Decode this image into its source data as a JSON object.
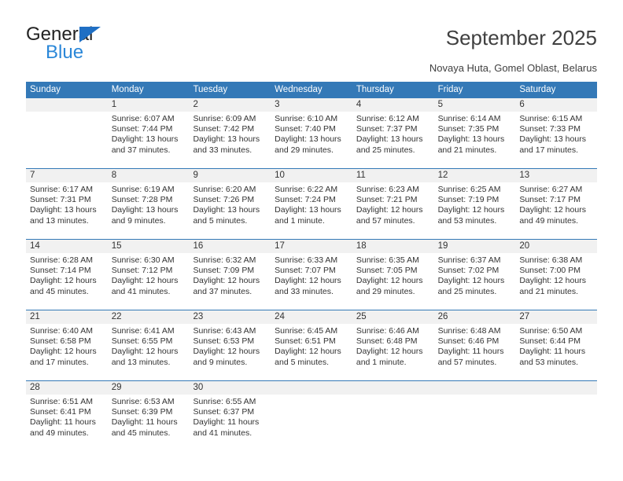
{
  "brand": {
    "name_dark": "General",
    "name_blue": "Blue",
    "accent_blue": "#2a87d8",
    "header_blue": "#3479b7"
  },
  "header": {
    "title": "September 2025",
    "subtitle": "Novaya Huta, Gomel Oblast, Belarus"
  },
  "calendar": {
    "weekdays": [
      "Sunday",
      "Monday",
      "Tuesday",
      "Wednesday",
      "Thursday",
      "Friday",
      "Saturday"
    ],
    "weeks": [
      [
        {
          "day": "",
          "sunrise": "",
          "sunset": "",
          "daylight_a": "",
          "daylight_b": ""
        },
        {
          "day": "1",
          "sunrise": "Sunrise: 6:07 AM",
          "sunset": "Sunset: 7:44 PM",
          "daylight_a": "Daylight: 13 hours",
          "daylight_b": "and 37 minutes."
        },
        {
          "day": "2",
          "sunrise": "Sunrise: 6:09 AM",
          "sunset": "Sunset: 7:42 PM",
          "daylight_a": "Daylight: 13 hours",
          "daylight_b": "and 33 minutes."
        },
        {
          "day": "3",
          "sunrise": "Sunrise: 6:10 AM",
          "sunset": "Sunset: 7:40 PM",
          "daylight_a": "Daylight: 13 hours",
          "daylight_b": "and 29 minutes."
        },
        {
          "day": "4",
          "sunrise": "Sunrise: 6:12 AM",
          "sunset": "Sunset: 7:37 PM",
          "daylight_a": "Daylight: 13 hours",
          "daylight_b": "and 25 minutes."
        },
        {
          "day": "5",
          "sunrise": "Sunrise: 6:14 AM",
          "sunset": "Sunset: 7:35 PM",
          "daylight_a": "Daylight: 13 hours",
          "daylight_b": "and 21 minutes."
        },
        {
          "day": "6",
          "sunrise": "Sunrise: 6:15 AM",
          "sunset": "Sunset: 7:33 PM",
          "daylight_a": "Daylight: 13 hours",
          "daylight_b": "and 17 minutes."
        }
      ],
      [
        {
          "day": "7",
          "sunrise": "Sunrise: 6:17 AM",
          "sunset": "Sunset: 7:31 PM",
          "daylight_a": "Daylight: 13 hours",
          "daylight_b": "and 13 minutes."
        },
        {
          "day": "8",
          "sunrise": "Sunrise: 6:19 AM",
          "sunset": "Sunset: 7:28 PM",
          "daylight_a": "Daylight: 13 hours",
          "daylight_b": "and 9 minutes."
        },
        {
          "day": "9",
          "sunrise": "Sunrise: 6:20 AM",
          "sunset": "Sunset: 7:26 PM",
          "daylight_a": "Daylight: 13 hours",
          "daylight_b": "and 5 minutes."
        },
        {
          "day": "10",
          "sunrise": "Sunrise: 6:22 AM",
          "sunset": "Sunset: 7:24 PM",
          "daylight_a": "Daylight: 13 hours",
          "daylight_b": "and 1 minute."
        },
        {
          "day": "11",
          "sunrise": "Sunrise: 6:23 AM",
          "sunset": "Sunset: 7:21 PM",
          "daylight_a": "Daylight: 12 hours",
          "daylight_b": "and 57 minutes."
        },
        {
          "day": "12",
          "sunrise": "Sunrise: 6:25 AM",
          "sunset": "Sunset: 7:19 PM",
          "daylight_a": "Daylight: 12 hours",
          "daylight_b": "and 53 minutes."
        },
        {
          "day": "13",
          "sunrise": "Sunrise: 6:27 AM",
          "sunset": "Sunset: 7:17 PM",
          "daylight_a": "Daylight: 12 hours",
          "daylight_b": "and 49 minutes."
        }
      ],
      [
        {
          "day": "14",
          "sunrise": "Sunrise: 6:28 AM",
          "sunset": "Sunset: 7:14 PM",
          "daylight_a": "Daylight: 12 hours",
          "daylight_b": "and 45 minutes."
        },
        {
          "day": "15",
          "sunrise": "Sunrise: 6:30 AM",
          "sunset": "Sunset: 7:12 PM",
          "daylight_a": "Daylight: 12 hours",
          "daylight_b": "and 41 minutes."
        },
        {
          "day": "16",
          "sunrise": "Sunrise: 6:32 AM",
          "sunset": "Sunset: 7:09 PM",
          "daylight_a": "Daylight: 12 hours",
          "daylight_b": "and 37 minutes."
        },
        {
          "day": "17",
          "sunrise": "Sunrise: 6:33 AM",
          "sunset": "Sunset: 7:07 PM",
          "daylight_a": "Daylight: 12 hours",
          "daylight_b": "and 33 minutes."
        },
        {
          "day": "18",
          "sunrise": "Sunrise: 6:35 AM",
          "sunset": "Sunset: 7:05 PM",
          "daylight_a": "Daylight: 12 hours",
          "daylight_b": "and 29 minutes."
        },
        {
          "day": "19",
          "sunrise": "Sunrise: 6:37 AM",
          "sunset": "Sunset: 7:02 PM",
          "daylight_a": "Daylight: 12 hours",
          "daylight_b": "and 25 minutes."
        },
        {
          "day": "20",
          "sunrise": "Sunrise: 6:38 AM",
          "sunset": "Sunset: 7:00 PM",
          "daylight_a": "Daylight: 12 hours",
          "daylight_b": "and 21 minutes."
        }
      ],
      [
        {
          "day": "21",
          "sunrise": "Sunrise: 6:40 AM",
          "sunset": "Sunset: 6:58 PM",
          "daylight_a": "Daylight: 12 hours",
          "daylight_b": "and 17 minutes."
        },
        {
          "day": "22",
          "sunrise": "Sunrise: 6:41 AM",
          "sunset": "Sunset: 6:55 PM",
          "daylight_a": "Daylight: 12 hours",
          "daylight_b": "and 13 minutes."
        },
        {
          "day": "23",
          "sunrise": "Sunrise: 6:43 AM",
          "sunset": "Sunset: 6:53 PM",
          "daylight_a": "Daylight: 12 hours",
          "daylight_b": "and 9 minutes."
        },
        {
          "day": "24",
          "sunrise": "Sunrise: 6:45 AM",
          "sunset": "Sunset: 6:51 PM",
          "daylight_a": "Daylight: 12 hours",
          "daylight_b": "and 5 minutes."
        },
        {
          "day": "25",
          "sunrise": "Sunrise: 6:46 AM",
          "sunset": "Sunset: 6:48 PM",
          "daylight_a": "Daylight: 12 hours",
          "daylight_b": "and 1 minute."
        },
        {
          "day": "26",
          "sunrise": "Sunrise: 6:48 AM",
          "sunset": "Sunset: 6:46 PM",
          "daylight_a": "Daylight: 11 hours",
          "daylight_b": "and 57 minutes."
        },
        {
          "day": "27",
          "sunrise": "Sunrise: 6:50 AM",
          "sunset": "Sunset: 6:44 PM",
          "daylight_a": "Daylight: 11 hours",
          "daylight_b": "and 53 minutes."
        }
      ],
      [
        {
          "day": "28",
          "sunrise": "Sunrise: 6:51 AM",
          "sunset": "Sunset: 6:41 PM",
          "daylight_a": "Daylight: 11 hours",
          "daylight_b": "and 49 minutes."
        },
        {
          "day": "29",
          "sunrise": "Sunrise: 6:53 AM",
          "sunset": "Sunset: 6:39 PM",
          "daylight_a": "Daylight: 11 hours",
          "daylight_b": "and 45 minutes."
        },
        {
          "day": "30",
          "sunrise": "Sunrise: 6:55 AM",
          "sunset": "Sunset: 6:37 PM",
          "daylight_a": "Daylight: 11 hours",
          "daylight_b": "and 41 minutes."
        },
        {
          "day": "",
          "sunrise": "",
          "sunset": "",
          "daylight_a": "",
          "daylight_b": ""
        },
        {
          "day": "",
          "sunrise": "",
          "sunset": "",
          "daylight_a": "",
          "daylight_b": ""
        },
        {
          "day": "",
          "sunrise": "",
          "sunset": "",
          "daylight_a": "",
          "daylight_b": ""
        },
        {
          "day": "",
          "sunrise": "",
          "sunset": "",
          "daylight_a": "",
          "daylight_b": ""
        }
      ]
    ]
  }
}
